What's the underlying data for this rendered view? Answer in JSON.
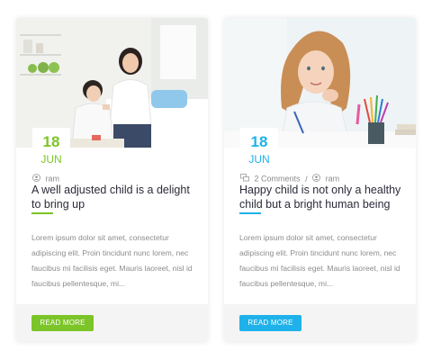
{
  "colors": {
    "green_accent": "#7cc528",
    "blue_accent": "#1fb2ea",
    "title_text": "#2b2b3a",
    "body_text": "#8c8c8c"
  },
  "posts": [
    {
      "image": "mother-and-son-photo",
      "date": {
        "day": "18",
        "month": "JUN"
      },
      "meta": {
        "author_icon": "user-icon",
        "author": "ram"
      },
      "title": "A well adjusted child is a delight to bring up",
      "excerpt": "Lorem ipsum dolor sit amet, consectetur adipiscing elit. Proin tincidunt nunc lorem, nec faucibus mi facilisis eget. Mauris laoreet, nisl id faucibus pellentesque, mi...",
      "button": "READ MORE"
    },
    {
      "image": "girl-drawing-photo",
      "date": {
        "day": "18",
        "month": "JUN"
      },
      "meta": {
        "comments_icon": "comments-icon",
        "comments": "2 Comments",
        "separator": "/",
        "author_icon": "user-icon",
        "author": "ram"
      },
      "title": "Happy child is not only a healthy child but a bright human being",
      "excerpt": "Lorem ipsum dolor sit amet, consectetur adipiscing elit. Proin tincidunt nunc lorem, nec faucibus mi facilisis eget. Mauris laoreet, nisl id faucibus pellentesque, mi...",
      "button": "READ MORE"
    }
  ]
}
